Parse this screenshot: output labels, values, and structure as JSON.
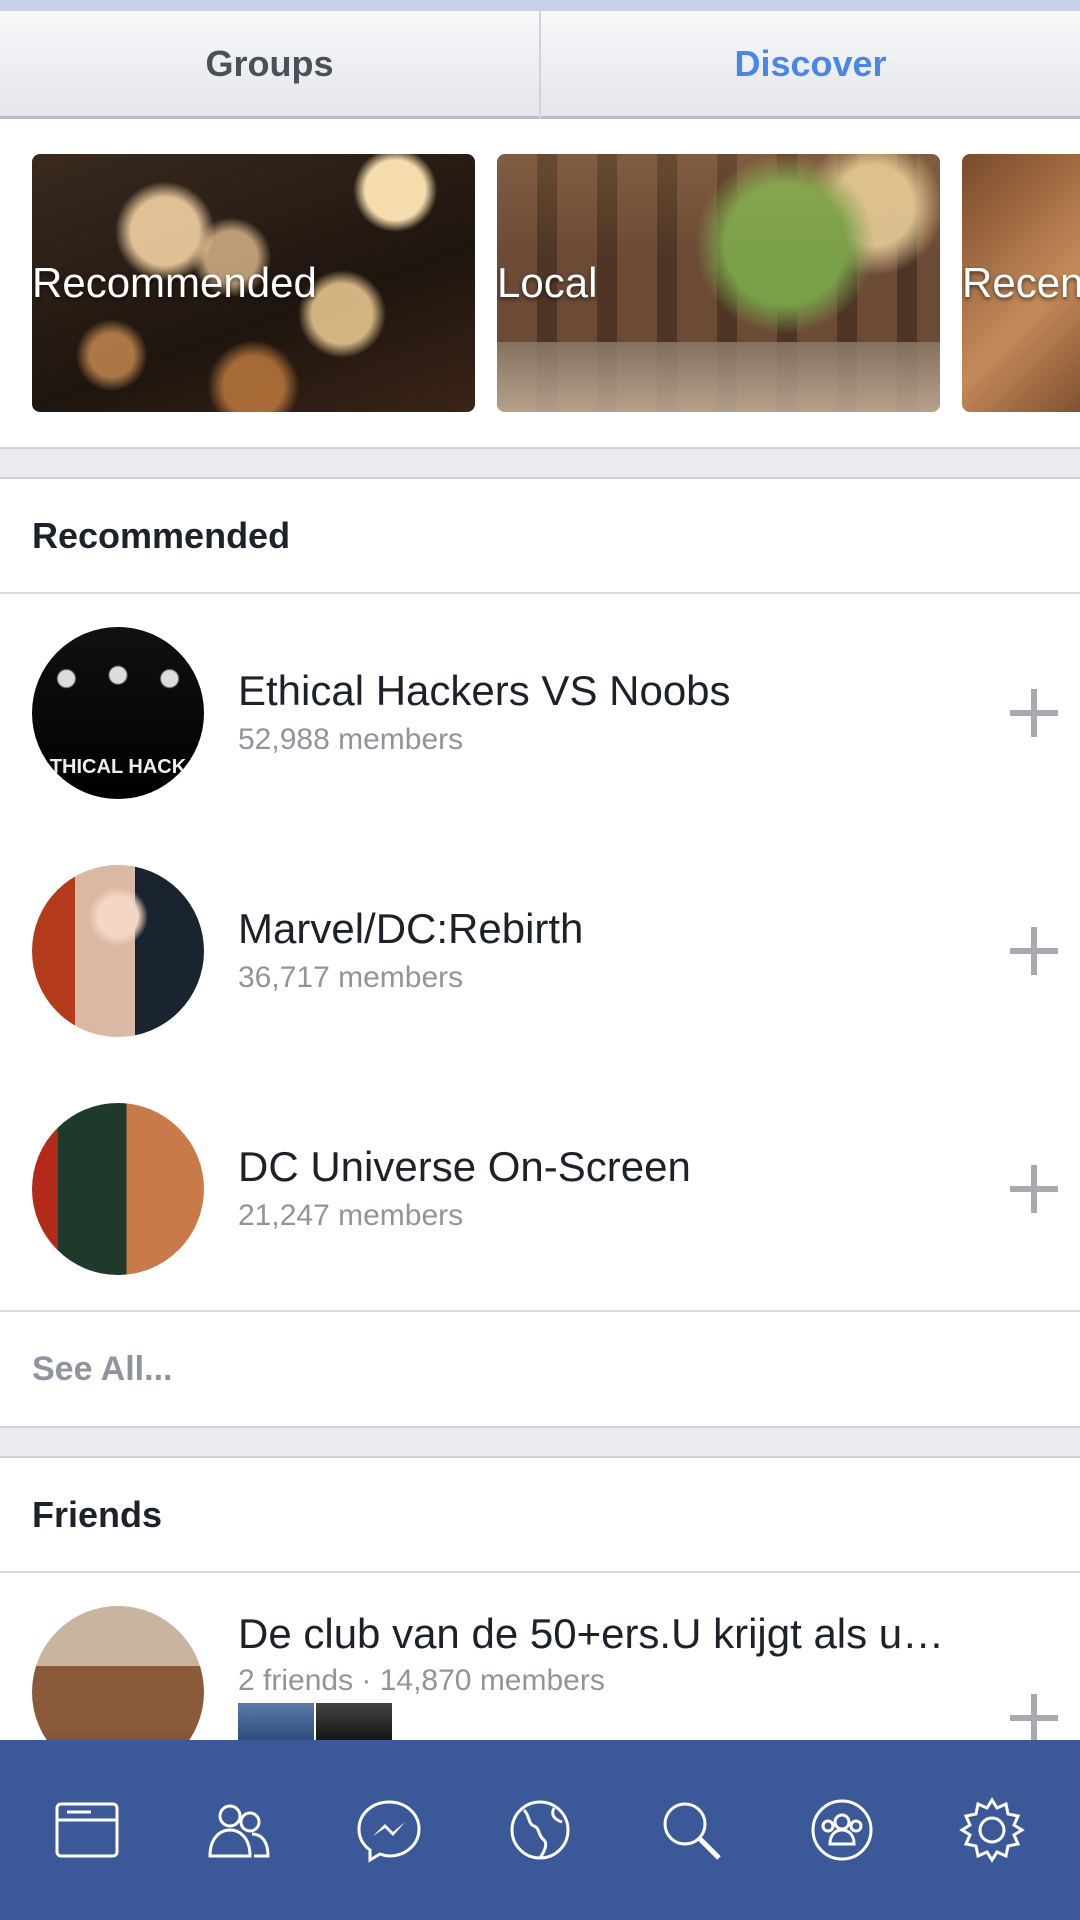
{
  "tabs": [
    {
      "label": "Groups",
      "active": false
    },
    {
      "label": "Discover",
      "active": true
    }
  ],
  "categories": [
    {
      "label": "Recommended"
    },
    {
      "label": "Local"
    },
    {
      "label": "Recen"
    }
  ],
  "recommended": {
    "header": "Recommended",
    "groups": [
      {
        "name": "Ethical Hackers VS Noobs",
        "meta": "52,988 members",
        "avatar_text": "THICAL HACK"
      },
      {
        "name": "Marvel/DC:Rebirth",
        "meta": "36,717 members"
      },
      {
        "name": "DC Universe On-Screen",
        "meta": "21,247 members"
      }
    ],
    "see_all": "See All..."
  },
  "friends": {
    "header": "Friends",
    "groups": [
      {
        "name": "De club van de 50+ers.U krijgt als u…",
        "meta": "2 friends · 14,870 members"
      }
    ]
  },
  "bottom_nav": [
    {
      "icon": "news-feed-icon"
    },
    {
      "icon": "friends-icon"
    },
    {
      "icon": "messenger-icon"
    },
    {
      "icon": "globe-icon"
    },
    {
      "icon": "search-icon"
    },
    {
      "icon": "groups-icon"
    },
    {
      "icon": "settings-gear-icon"
    }
  ],
  "colors": {
    "nav_bar": "#3b5998",
    "active_tab": "#4a86e8",
    "muted_text": "#90949c"
  }
}
